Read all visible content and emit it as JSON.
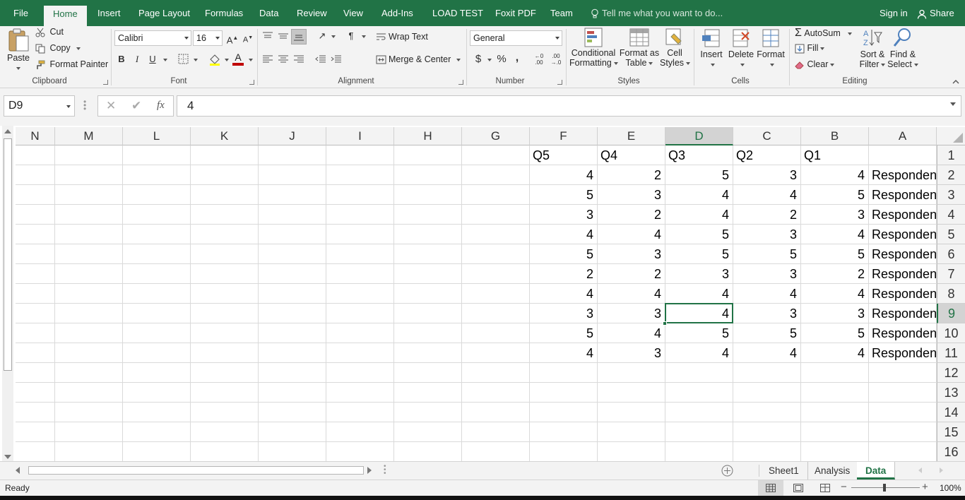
{
  "tabs": {
    "file": "File",
    "home": "Home",
    "insert": "Insert",
    "page_layout": "Page Layout",
    "formulas": "Formulas",
    "data": "Data",
    "review": "Review",
    "view": "View",
    "add_ins": "Add-Ins",
    "load_test": "LOAD TEST",
    "foxit": "Foxit PDF",
    "team": "Team"
  },
  "tell_me": "Tell me what you want to do...",
  "sign_in": "Sign in",
  "share": "Share",
  "ribbon": {
    "clipboard": {
      "paste": "Paste",
      "cut": "Cut",
      "copy": "Copy",
      "format_painter": "Format Painter",
      "label": "Clipboard"
    },
    "font": {
      "name": "Calibri",
      "size": "16",
      "label": "Font",
      "accent_color": "#c00000"
    },
    "alignment": {
      "wrap_text": "Wrap Text",
      "merge_center": "Merge & Center",
      "label": "Alignment"
    },
    "number": {
      "format": "General",
      "label": "Number"
    },
    "styles": {
      "conditional": "Conditional",
      "formatting": "Formatting",
      "format_as": "Format as",
      "table": "Table",
      "cell": "Cell",
      "styles": "Styles",
      "label": "Styles"
    },
    "cells": {
      "insert": "Insert",
      "delete": "Delete",
      "format": "Format",
      "label": "Cells"
    },
    "editing": {
      "autosum": "AutoSum",
      "fill": "Fill",
      "clear": "Clear",
      "sort": "Sort &",
      "filter": "Filter",
      "find": "Find &",
      "select": "Select",
      "label": "Editing"
    }
  },
  "formula_bar": {
    "name_box": "D9",
    "fx": "fx",
    "value": "4"
  },
  "columns": [
    "N",
    "M",
    "L",
    "K",
    "J",
    "I",
    "H",
    "G",
    "F",
    "E",
    "D",
    "C",
    "B",
    "A"
  ],
  "selected_column": "D",
  "rows": [
    "1",
    "2",
    "3",
    "4",
    "5",
    "6",
    "7",
    "8",
    "9",
    "10",
    "11",
    "12",
    "13",
    "14",
    "15",
    "16"
  ],
  "selected_row": "9",
  "headers": {
    "A": "",
    "B": "Q1",
    "C": "Q2",
    "D": "Q3",
    "E": "Q4",
    "F": "Q5"
  },
  "data_rows": [
    {
      "A": "Responden",
      "B": "4",
      "C": "3",
      "D": "5",
      "E": "2",
      "F": "4"
    },
    {
      "A": "Responden",
      "B": "5",
      "C": "4",
      "D": "4",
      "E": "3",
      "F": "5"
    },
    {
      "A": "Responden",
      "B": "3",
      "C": "2",
      "D": "4",
      "E": "2",
      "F": "3"
    },
    {
      "A": "Responden",
      "B": "4",
      "C": "3",
      "D": "5",
      "E": "4",
      "F": "4"
    },
    {
      "A": "Responden",
      "B": "5",
      "C": "5",
      "D": "5",
      "E": "3",
      "F": "5"
    },
    {
      "A": "Responden",
      "B": "2",
      "C": "3",
      "D": "3",
      "E": "2",
      "F": "2"
    },
    {
      "A": "Responden",
      "B": "4",
      "C": "4",
      "D": "4",
      "E": "4",
      "F": "4"
    },
    {
      "A": "Responden",
      "B": "3",
      "C": "3",
      "D": "4",
      "E": "3",
      "F": "3"
    },
    {
      "A": "Responden",
      "B": "5",
      "C": "5",
      "D": "5",
      "E": "4",
      "F": "5"
    },
    {
      "A": "Responden",
      "B": "4",
      "C": "4",
      "D": "4",
      "E": "3",
      "F": "4"
    }
  ],
  "sheets": [
    "Sheet1",
    "Analysis",
    "Data"
  ],
  "active_sheet": "Data",
  "status": {
    "text": "Ready",
    "zoom": "100%"
  },
  "colors": {
    "accent": "#217346"
  }
}
